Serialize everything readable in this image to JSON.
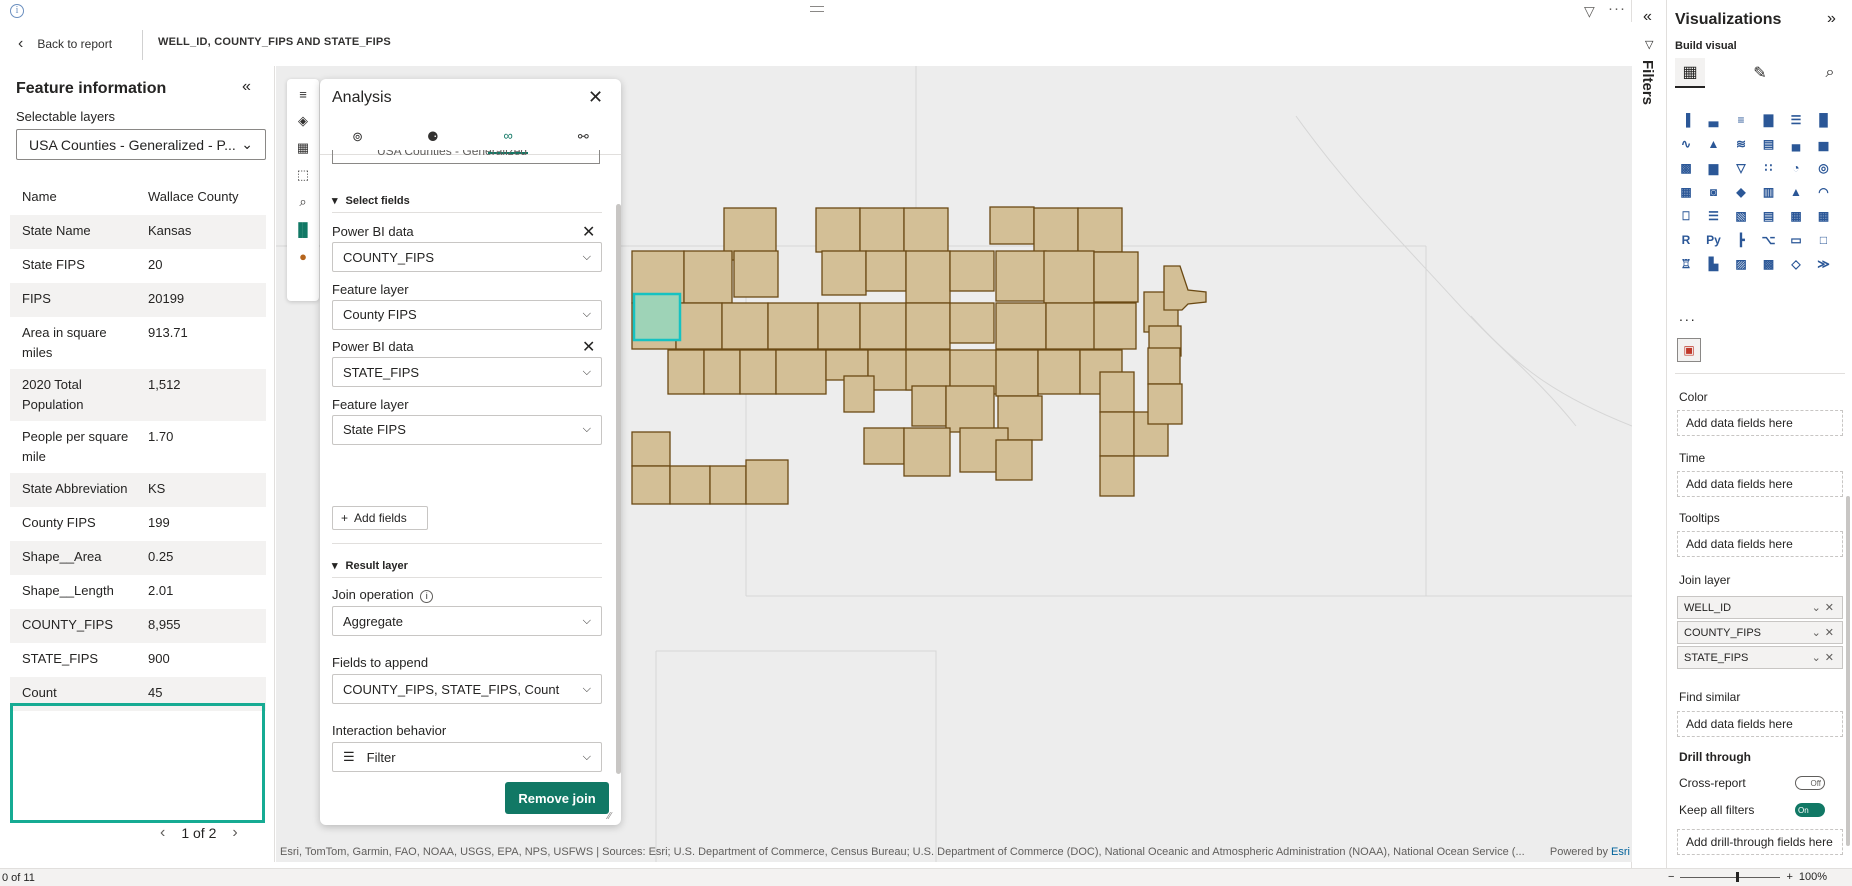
{
  "header": {
    "back_label": "Back to report",
    "title": "WELL_ID, COUNTY_FIPS AND STATE_FIPS"
  },
  "feature_panel": {
    "title": "Feature information",
    "layers_label": "Selectable layers",
    "layer_value": "USA Counties - Generalized - P...",
    "rows": [
      {
        "key": "Name",
        "value": "Wallace County"
      },
      {
        "key": "State Name",
        "value": "Kansas"
      },
      {
        "key": "State FIPS",
        "value": "20"
      },
      {
        "key": "FIPS",
        "value": "20199"
      },
      {
        "key": "Area in square miles",
        "value": "913.71"
      },
      {
        "key": "2020 Total Population",
        "value": "1,512"
      },
      {
        "key": "People per square mile",
        "value": "1.70"
      },
      {
        "key": "State Abbreviation",
        "value": "KS"
      },
      {
        "key": "County FIPS",
        "value": "199"
      },
      {
        "key": "Shape__Area",
        "value": "0.25"
      },
      {
        "key": "Shape__Length",
        "value": "2.01"
      },
      {
        "key": "COUNTY_FIPS",
        "value": "8,955"
      },
      {
        "key": "STATE_FIPS",
        "value": "900"
      },
      {
        "key": "Count",
        "value": "45"
      }
    ],
    "pager": "1 of 2"
  },
  "analysis": {
    "title": "Analysis",
    "clipped_text": "USA Counties - Generalized",
    "select_fields_label": "Select fields",
    "fields": [
      {
        "label": "Power BI data",
        "value": "COUNTY_FIPS",
        "removable": true
      },
      {
        "label": "Feature layer",
        "value": "County FIPS",
        "removable": false
      },
      {
        "label": "Power BI data",
        "value": "STATE_FIPS",
        "removable": true
      },
      {
        "label": "Feature layer",
        "value": "State FIPS",
        "removable": false
      }
    ],
    "add_fields_label": "Add fields",
    "result_layer_label": "Result layer",
    "join_operation_label": "Join operation",
    "join_operation_value": "Aggregate",
    "fields_to_append_label": "Fields to append",
    "fields_to_append_value": "COUNTY_FIPS, STATE_FIPS, Count",
    "interaction_label": "Interaction behavior",
    "interaction_value": "Filter",
    "remove_join_label": "Remove join"
  },
  "map": {
    "attribution": "Esri, TomTom, Garmin, FAO, NOAA, USGS, EPA, NPS, USFWS | Sources: Esri; U.S. Department of Commerce, Census Bureau; U.S. Department of Commerce (DOC), National Oceanic and Atmospheric Administration (NOAA), National Ocean Service (...",
    "powered_by": "Powered by",
    "powered_by_link": "Esri",
    "county_fill": "#d3bf96",
    "county_stroke": "#6b4a14",
    "selected_fill": "#9ed3b7",
    "selected_stroke": "#16c2c2"
  },
  "filters_pane": {
    "label": "Filters"
  },
  "viz_pane": {
    "title": "Visualizations",
    "build_label": "Build visual",
    "more": "...",
    "wells": [
      {
        "label": "Color",
        "placeholder": "Add data fields here"
      },
      {
        "label": "Time",
        "placeholder": "Add data fields here"
      },
      {
        "label": "Tooltips",
        "placeholder": "Add data fields here"
      }
    ],
    "join_layer_label": "Join layer",
    "join_fields": [
      "WELL_ID",
      "COUNTY_FIPS",
      "STATE_FIPS"
    ],
    "find_similar_label": "Find similar",
    "find_similar_placeholder": "Add data fields here",
    "drill_label": "Drill through",
    "cross_report_label": "Cross-report",
    "cross_report_state": "Off",
    "keep_filters_label": "Keep all filters",
    "keep_filters_state": "On",
    "drill_placeholder": "Add drill-through fields here"
  },
  "status": {
    "page": "0 of 11",
    "zoom": "100%"
  }
}
